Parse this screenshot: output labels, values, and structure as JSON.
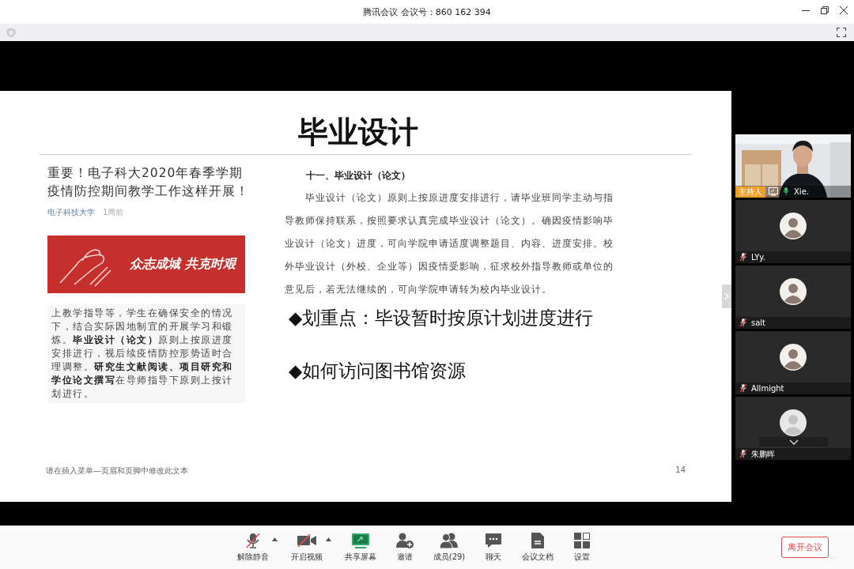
{
  "window": {
    "title": "腾讯会议 会议号：860 162 394"
  },
  "slide": {
    "title": "毕业设计",
    "article": {
      "headline": "重要！电子科大2020年春季学期疫情防控期间教学工作这样开展！",
      "source": "电子科技大学",
      "time": "1周前",
      "banner_text": "众志成城 共克时艰",
      "paragraph": "上教学指导等，学生在确保安全的情况下，结合实际因地制宜的开展学习和锻炼。**毕业设计（论文）**原则上按原进度安排进行，视后续疫情防控形势适时合理调整。**研究生文献阅读、项目研究和学位论文撰写**在导师指导下原则上按计划进行。"
    },
    "section_heading": "十一、毕业设计（论文）",
    "body": "毕业设计（论文）原则上按原进度安排进行，请毕业班同学主动与指导教师保持联系，按照要求认真完成毕业设计（论文）。确因疫情影响毕业设计（论文）进度，可向学院申请适度调整题目、内容、进度安排。校外毕业设计（外校、企业等）因疫情受影响，征求校外指导教师或单位的意见后，若无法继续的，可向学院申请转为校内毕业设计。",
    "bullets": [
      "◆划重点：毕设暂时按原计划进度进行",
      "◆如何访问图书馆资源"
    ],
    "footer": "请在插入菜单—页眉和页脚中修改此文本",
    "page_number": "14"
  },
  "participants": [
    {
      "name": "Xie.",
      "kind": "camera",
      "host_label": "主持人",
      "sharing": true,
      "muted": false
    },
    {
      "name": "LYy.",
      "kind": "avatar",
      "muted": true
    },
    {
      "name": "salt",
      "kind": "avatar",
      "muted": true
    },
    {
      "name": "Allmight",
      "kind": "avatar",
      "muted": true
    },
    {
      "name": "朱鹏晖",
      "kind": "default",
      "muted": true
    }
  ],
  "toolbar": [
    {
      "label": "解除静音",
      "kind": "mic",
      "off": true,
      "menu": true
    },
    {
      "label": "开启视频",
      "kind": "video",
      "off": true,
      "menu": true
    },
    {
      "label": "共享屏幕",
      "kind": "share"
    },
    {
      "label": "邀请",
      "kind": "invite"
    },
    {
      "label": "成员(29)",
      "kind": "members"
    },
    {
      "label": "聊天",
      "kind": "chat"
    },
    {
      "label": "会议文档",
      "kind": "doc"
    },
    {
      "label": "设置",
      "kind": "settings"
    }
  ],
  "leave_button": "离开会议"
}
